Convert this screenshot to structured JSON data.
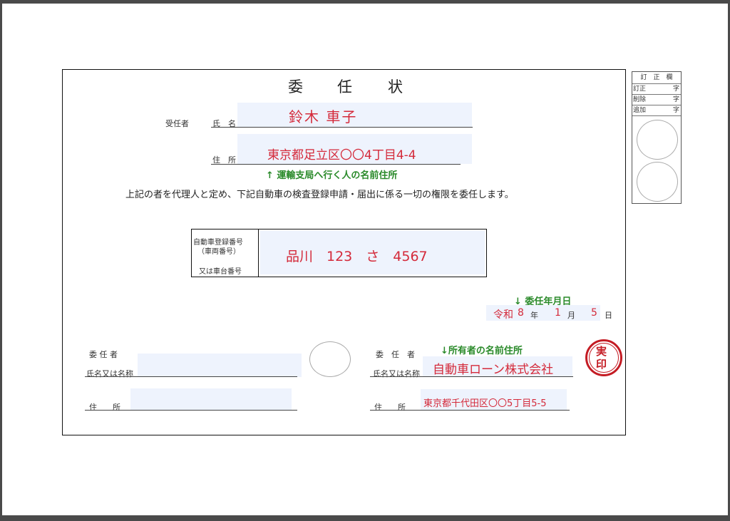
{
  "document": {
    "title_chars": [
      "委",
      "任",
      "状"
    ],
    "agent": {
      "role_label": "受任者",
      "name_label": "氏　名",
      "name_value": "鈴木 車子",
      "address_label": "住　所",
      "address_value": "東京都足立区〇〇4丁目4-4",
      "hint": "↑ 運輸支局へ行く人の名前住所"
    },
    "statement": "上記の者を代理人と定め、下記自動車の検査登録申請・届出に係る一切の権限を委任します。",
    "vehicle": {
      "label_line1": "自動車登録番号",
      "label_line2": "（車両番号）",
      "label_line3": "又は車台番号",
      "value": "品川　123　さ　4567"
    },
    "date": {
      "hint": "↓ 委任年月日",
      "era": "令和",
      "year": "8",
      "year_unit": "年",
      "month": "1",
      "month_unit": "月",
      "day": "5",
      "day_unit": "日"
    },
    "principal_left": {
      "label": "委 任 者",
      "name_label": "氏名又は名称",
      "address_label": "住　　所"
    },
    "principal_right": {
      "label": "委　任　者",
      "hint": "↓所有者の名前住所",
      "name_label": "氏名又は名称",
      "name_value": "自動車ローン株式会社",
      "address_label": "住　　所",
      "address_value": "東京都千代田区〇〇5丁目5-5",
      "seal_line1": "実",
      "seal_line2": "印"
    }
  },
  "correction_box": {
    "header": "訂　正　欄",
    "rows": [
      {
        "label": "訂正",
        "unit": "字"
      },
      {
        "label": "削除",
        "unit": "字"
      },
      {
        "label": "追加",
        "unit": "字"
      }
    ]
  },
  "colors": {
    "fill": "#eef3fd",
    "red_text": "#d42a3a",
    "green_text": "#2a8a2a",
    "seal": "#c41c24"
  }
}
